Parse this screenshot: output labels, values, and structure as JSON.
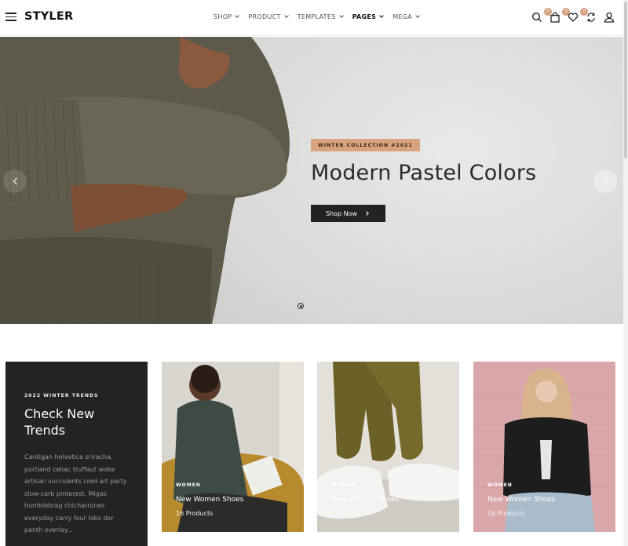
{
  "header": {
    "logo": "STYLER",
    "nav": [
      {
        "label": "SHOP",
        "active": false
      },
      {
        "label": "PRODUCT",
        "active": false
      },
      {
        "label": "TEMPLATES",
        "active": false
      },
      {
        "label": "PAGES",
        "active": true
      },
      {
        "label": "MEGA",
        "active": false
      }
    ],
    "icons": [
      {
        "name": "search-icon",
        "badge": null
      },
      {
        "name": "shopping-bag-icon",
        "badge": "0"
      },
      {
        "name": "heart-icon",
        "badge": "0"
      },
      {
        "name": "compare-icon",
        "badge": "0"
      }
    ],
    "account_icon": "user-icon",
    "menu_icon": "hamburger-icon"
  },
  "hero": {
    "tag": "WINTER COLLECTION #2021",
    "title": "Modern Pastel Colors",
    "button": "Shop Now",
    "prev_icon": "chevron-left-icon",
    "next_icon": "chevron-right-icon",
    "slides": 1,
    "active_slide": 1
  },
  "promo": {
    "eyebrow": "2022 WINTER TRENDS",
    "title": "Check New Trends",
    "text": "Cardigan helvetica sriracha, portland celiac truffaut woke artisan succulents cred art party slow-carb pinterest. Migas humblebrag chicharrones everyday carry four loko der panth overlay..."
  },
  "cards": [
    {
      "tag": "WOMEN",
      "name": "New Women Shoes",
      "count": "16 Products"
    },
    {
      "tag": "WOMEN",
      "name": "New Women Shoes",
      "count": "16 Products"
    },
    {
      "tag": "WOMEN",
      "name": "New Women Shoes",
      "count": "16 Products"
    }
  ],
  "colors": {
    "accent": "#d8a27c",
    "dark": "#232323",
    "badge": "#d4a07d"
  }
}
